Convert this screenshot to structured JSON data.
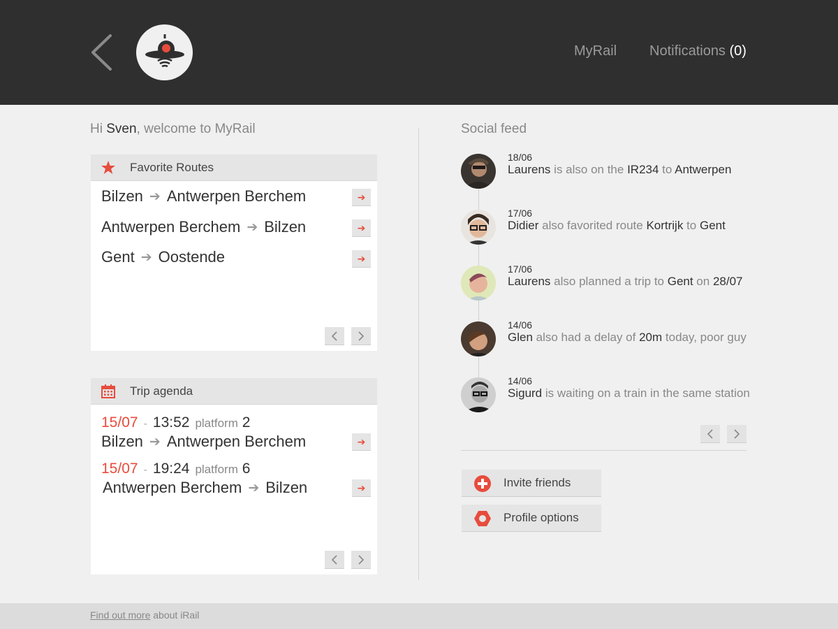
{
  "header": {
    "back_icon": "chevron-left-icon",
    "logo_icon": "irail-logo-icon",
    "nav_myrail": "MyRail",
    "nav_notifications": "Notifications",
    "nav_notifications_count": "(0)"
  },
  "greeting": {
    "prefix": "Hi ",
    "name": "Sven",
    "suffix": ", welcome to MyRail"
  },
  "favorites": {
    "title": "Favorite Routes",
    "icon": "star-icon",
    "routes": [
      {
        "from": "Bilzen",
        "to": "Antwerpen Berchem"
      },
      {
        "from": "Antwerpen Berchem",
        "to": "Bilzen"
      },
      {
        "from": "Gent",
        "to": "Oostende"
      }
    ]
  },
  "agenda": {
    "title": "Trip agenda",
    "icon": "calendar-icon",
    "platform_label": "platform",
    "trips": [
      {
        "date": "15/07",
        "dash": "-",
        "time": "13:52",
        "platform": "2",
        "from": "Bilzen",
        "to": "Antwerpen Berchem"
      },
      {
        "date": "15/07",
        "dash": "-",
        "time": "19:24",
        "platform": "6",
        "from": "Antwerpen Berchem",
        "to": "Bilzen"
      }
    ]
  },
  "feed": {
    "title": "Social feed",
    "items": [
      {
        "date": "18/06",
        "parts": [
          [
            "b",
            "Laurens"
          ],
          [
            "t",
            " is also on the "
          ],
          [
            "b",
            "IR234"
          ],
          [
            "t",
            " to "
          ],
          [
            "b",
            "Antwerpen"
          ]
        ]
      },
      {
        "date": "17/06",
        "parts": [
          [
            "b",
            "Didier"
          ],
          [
            "t",
            " also favorited route "
          ],
          [
            "b",
            "Kortrijk"
          ],
          [
            "t",
            " to "
          ],
          [
            "b",
            "Gent"
          ]
        ]
      },
      {
        "date": "17/06",
        "parts": [
          [
            "b",
            "Laurens"
          ],
          [
            "t",
            " also planned a trip to "
          ],
          [
            "b",
            "Gent"
          ],
          [
            "t",
            " on "
          ],
          [
            "b",
            "28/07"
          ]
        ]
      },
      {
        "date": "14/06",
        "parts": [
          [
            "b",
            "Glen"
          ],
          [
            "t",
            " also had a delay of "
          ],
          [
            "b",
            "20m"
          ],
          [
            "t",
            " today, poor guy"
          ]
        ]
      },
      {
        "date": "14/06",
        "parts": [
          [
            "b",
            "Sigurd"
          ],
          [
            "t",
            " is waiting on a train in the same station"
          ]
        ]
      }
    ]
  },
  "actions": {
    "invite": "Invite friends",
    "invite_icon": "plus-circle-icon",
    "profile": "Profile options",
    "profile_icon": "hexagon-icon"
  },
  "footer": {
    "link": "Find out more",
    "text": " about iRail"
  },
  "colors": {
    "accent": "#e74c3c",
    "header_bg": "#2f2f2f",
    "page_bg": "#f0f0f0"
  }
}
